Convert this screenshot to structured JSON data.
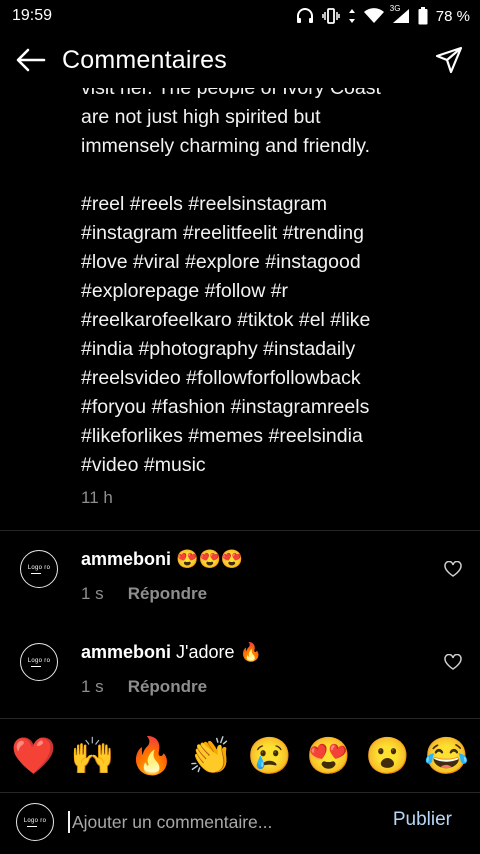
{
  "status_bar": {
    "time": "19:59",
    "network": "3G",
    "battery": "78 %"
  },
  "header": {
    "title": "Commentaires"
  },
  "caption": {
    "text": "visit her. The people of Ivory Coast\nare not just high spirited but\nimmensely charming and friendly.\n\n#reel #reels #reelsinstagram\n#instagram #reelitfeelit #trending\n#love #viral #explore #instagood\n#explorepage #follow #r\n#reelkarofeelkaro #tiktok #el #like\n#india #photography #instadaily\n#reelsvideo #followforfollowback\n#foryou #fashion #instagramreels\n#likeforlikes #memes #reelsindia\n#video #music",
    "time": "11 h"
  },
  "comments": [
    {
      "username": "ammeboni",
      "text": "😍😍😍",
      "time": "1 s",
      "reply_label": "Répondre"
    },
    {
      "username": "ammeboni",
      "text": "J'adore 🔥",
      "time": "1 s",
      "reply_label": "Répondre"
    }
  ],
  "avatar_logo": "Logo ro",
  "emoji_bar": [
    "❤️",
    "🙌",
    "🔥",
    "👏",
    "😢",
    "😍",
    "😮",
    "😂"
  ],
  "composer": {
    "placeholder": "Ajouter un commentaire...",
    "publish_label": "Publier"
  },
  "colors": {
    "background": "#000000",
    "secondary_text": "#8e8e8e",
    "publish": "#b6d6f7"
  }
}
